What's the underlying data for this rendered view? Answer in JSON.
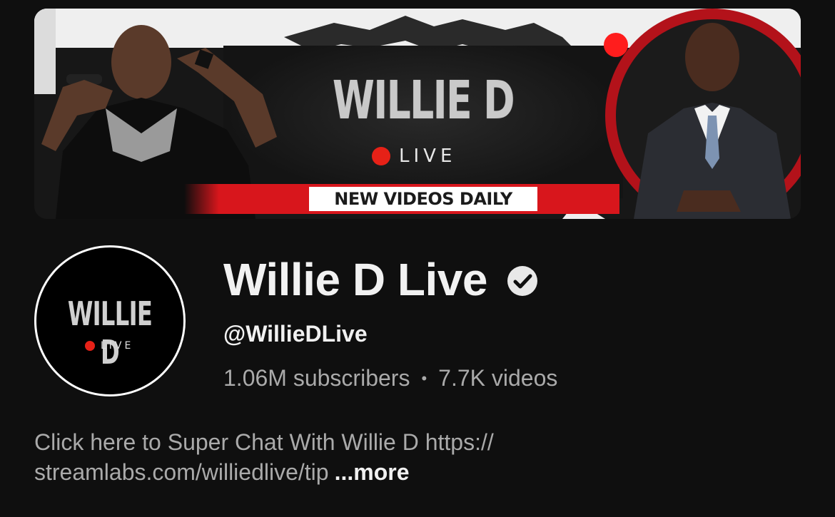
{
  "banner": {
    "title": "WILLIE D",
    "live_label": "LIVE",
    "tagline": "NEW VIDEOS DAILY"
  },
  "avatar": {
    "title": "WILLIE D",
    "live_label": "LIVE"
  },
  "channel": {
    "name": "Willie D Live",
    "handle": "@WillieDLive",
    "subscribers": "1.06M subscribers",
    "separator": "•",
    "videos": "7.7K videos",
    "description_line1": "Click here to Super Chat With Willie D https://",
    "description_line2": "streamlabs.com/williedlive/tip",
    "more_label": "...more"
  },
  "colors": {
    "background": "#0f0f0f",
    "accent_red": "#e62117",
    "primary_text": "#f1f1f1",
    "secondary_text": "#aaaaaa"
  },
  "icons": {
    "verified": "verified-check-icon"
  }
}
